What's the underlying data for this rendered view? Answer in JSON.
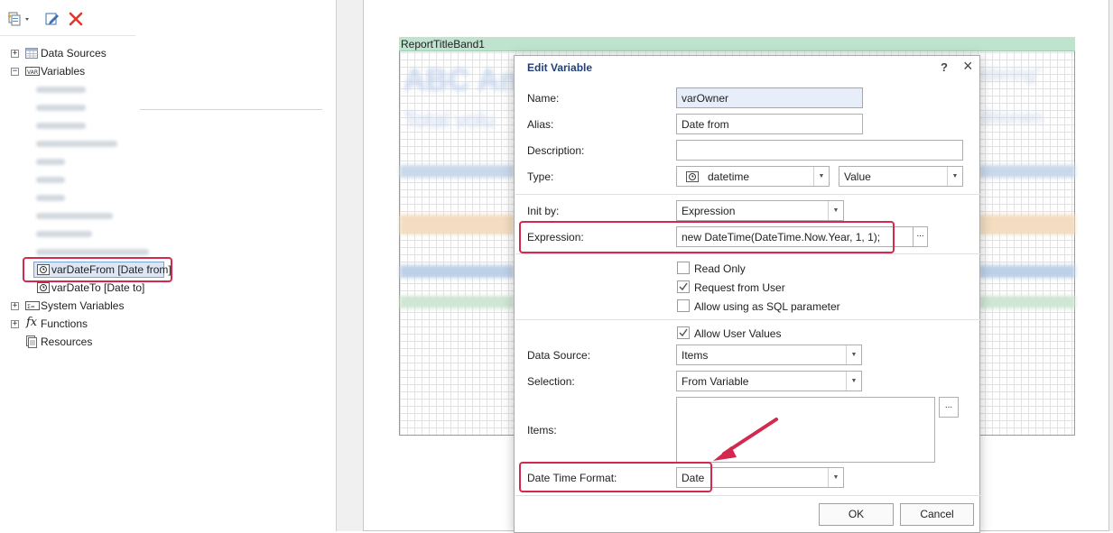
{
  "toolbar": {
    "new_icon": "new-item-dropdown-icon",
    "edit_icon": "edit-icon",
    "delete_icon": "delete-icon"
  },
  "tree": {
    "data_sources": "Data Sources",
    "variables": "Variables",
    "var_date_from": "varDateFrom [Date from]",
    "var_date_to": "varDateTo [Date to]",
    "system_variables": "System Variables",
    "functions": "Functions",
    "resources": "Resources",
    "expand_symbol": "+",
    "collapse_symbol": "−"
  },
  "report": {
    "band_title": "ReportTitleBand1"
  },
  "dialog": {
    "title": "Edit Variable",
    "help": "?",
    "close": "×",
    "name_label": "Name:",
    "name_value": "varOwner",
    "alias_label": "Alias:",
    "alias_value": "Date from",
    "description_label": "Description:",
    "description_value": "",
    "type_label": "Type:",
    "type_value": "datetime",
    "type_mode_value": "Value",
    "init_by_label": "Init by:",
    "init_by_value": "Expression",
    "expression_label": "Expression:",
    "expression_value": "new DateTime(DateTime.Now.Year, 1, 1);",
    "ellipsis": "...",
    "read_only_label": "Read Only",
    "read_only_checked": false,
    "request_from_user_label": "Request from User",
    "request_from_user_checked": true,
    "allow_sql_label": "Allow using as SQL parameter",
    "allow_sql_checked": false,
    "allow_user_values_label": "Allow User Values",
    "allow_user_values_checked": true,
    "data_source_label": "Data Source:",
    "data_source_value": "Items",
    "selection_label": "Selection:",
    "selection_value": "From Variable",
    "items_label": "Items:",
    "date_time_format_label": "Date Time Format:",
    "date_time_format_value": "Date",
    "ok_label": "OK",
    "cancel_label": "Cancel"
  },
  "colors": {
    "highlight": "#d4294e",
    "dialog_title": "#1f3f7a",
    "band_title_bg": "#bfe3cf",
    "selected_tree_bg": "#dce6f4"
  }
}
